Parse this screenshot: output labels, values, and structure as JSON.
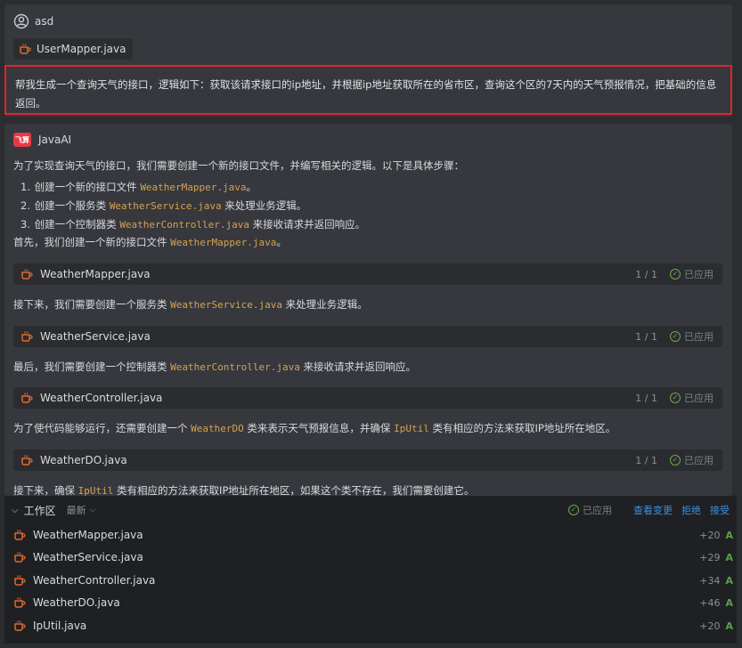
{
  "user": {
    "name": "asd",
    "attached_file": "UserMapper.java",
    "question": "帮我生成一个查询天气的接口，逻辑如下：获取该请求接口的ip地址，并根据ip地址获取所在的省市区，查询这个区的7天内的天气预报情况，把基础的信息返回。"
  },
  "ai": {
    "logo_text": "飞算",
    "name": "JavaAI",
    "intro": "为了实现查询天气的接口，我们需要创建一个新的接口文件，并编写相关的逻辑。以下是具体步骤：",
    "steps": [
      {
        "num": "1.",
        "pre": "创建一个新的接口文件 ",
        "code": "WeatherMapper.java",
        "post": "。"
      },
      {
        "num": "2.",
        "pre": "创建一个服务类 ",
        "code": "WeatherService.java",
        "post": " 来处理业务逻辑。"
      },
      {
        "num": "3.",
        "pre": "创建一个控制器类 ",
        "code": "WeatherController.java",
        "post": " 来接收请求并返回响应。"
      }
    ],
    "first": {
      "pre": "首先，我们创建一个新的接口文件 ",
      "code": "WeatherMapper.java",
      "post": "。"
    },
    "files": [
      {
        "name": "WeatherMapper.java",
        "count": "1 / 1",
        "status": "已应用"
      },
      {
        "name": "WeatherService.java",
        "count": "1 / 1",
        "status": "已应用"
      },
      {
        "name": "WeatherController.java",
        "count": "1 / 1",
        "status": "已应用"
      },
      {
        "name": "WeatherDO.java",
        "count": "1 / 1",
        "status": "已应用"
      }
    ],
    "next1": {
      "pre": "接下来，我们需要创建一个服务类 ",
      "code": "WeatherService.java",
      "post": " 来处理业务逻辑。"
    },
    "last": {
      "pre": "最后，我们需要创建一个控制器类 ",
      "code": "WeatherController.java",
      "post": " 来接收请求并返回响应。"
    },
    "extra": {
      "pre": "为了使代码能够运行，还需要创建一个 ",
      "code": "WeatherDO",
      "mid": " 类来表示天气预报信息，并确保 ",
      "code2": "IpUtil",
      "post": " 类有相应的方法来获取IP地址所在地区。"
    },
    "cut": {
      "pre": "接下来，确保 ",
      "code": "IpUtil",
      "post": " 类有相应的方法来获取IP地址所在地区，如果这个类不存在，我们需要创建它。"
    }
  },
  "workspace": {
    "title": "工作区",
    "filter": "最新",
    "applied": "已应用",
    "view_changes": "查看变更",
    "reject": "拒绝",
    "accept": "接受",
    "files": [
      {
        "name": "WeatherMapper.java",
        "added": "+20",
        "status": "A"
      },
      {
        "name": "WeatherService.java",
        "added": "+29",
        "status": "A"
      },
      {
        "name": "WeatherController.java",
        "added": "+34",
        "status": "A"
      },
      {
        "name": "WeatherDO.java",
        "added": "+46",
        "status": "A"
      },
      {
        "name": "IpUtil.java",
        "added": "+20",
        "status": "A"
      }
    ]
  },
  "colors": {
    "accent_link": "#3d8fe0",
    "highlight_border": "#e1232e",
    "code_text": "#d5a250",
    "added_status": "#56a24a"
  }
}
